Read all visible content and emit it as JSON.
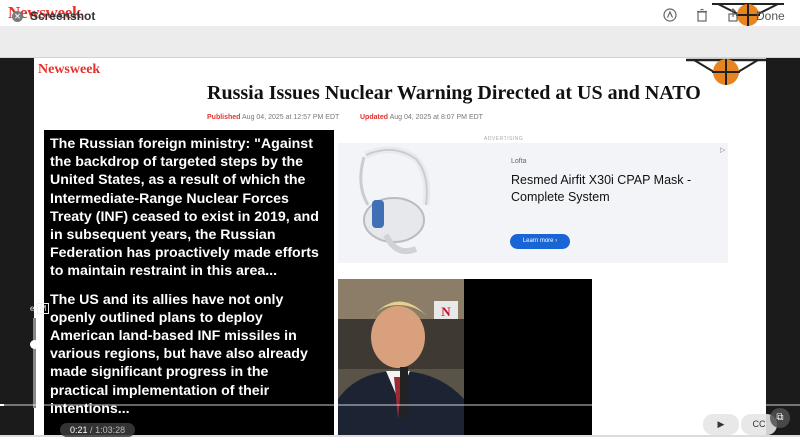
{
  "top": {
    "logo": "Newsweek"
  },
  "quicklook": {
    "title": "Screenshot",
    "done_label": "Done",
    "icons": [
      "close-icon",
      "markup-icon",
      "trash-icon",
      "share-icon"
    ]
  },
  "article": {
    "logo": "Newsweek",
    "headline": "Russia Issues Nuclear Warning Directed at US and NATO",
    "published_label": "Published",
    "published_date": "Aug 04, 2025 at 12:57 PM EDT",
    "updated_label": "Updated",
    "updated_date": "Aug 04, 2025 at 8:07 PM EDT",
    "quote_p1": "The Russian foreign ministry: \"Against the backdrop of targeted steps by the United States, as a result of which the Intermediate-Range Nuclear Forces Treaty (INF) ceased to exist in 2019, and in subsequent years, the Russian Federation has proactively made efforts to maintain restraint in this area...",
    "quote_p2": "The US and its allies have not only openly outlined plans to deploy American land-based INF missiles in various regions, but have also already made significant progress in the practical implementation of their intentions..."
  },
  "ad": {
    "label": "ADVERTISING",
    "brand": "Lofta",
    "title": "Resmed Airfit X30i CPAP Mask - Complete System",
    "button": "Learn more",
    "button_icon": "chevron-right-icon"
  },
  "player": {
    "mode_label": "M",
    "current_time": "0:21",
    "duration": "1:03:28",
    "progress": 0.0055,
    "play_icon": "play-icon",
    "cc_label": "CC"
  },
  "colors": {
    "brand_red": "#e4322b",
    "ad_button": "#1a65d6"
  }
}
